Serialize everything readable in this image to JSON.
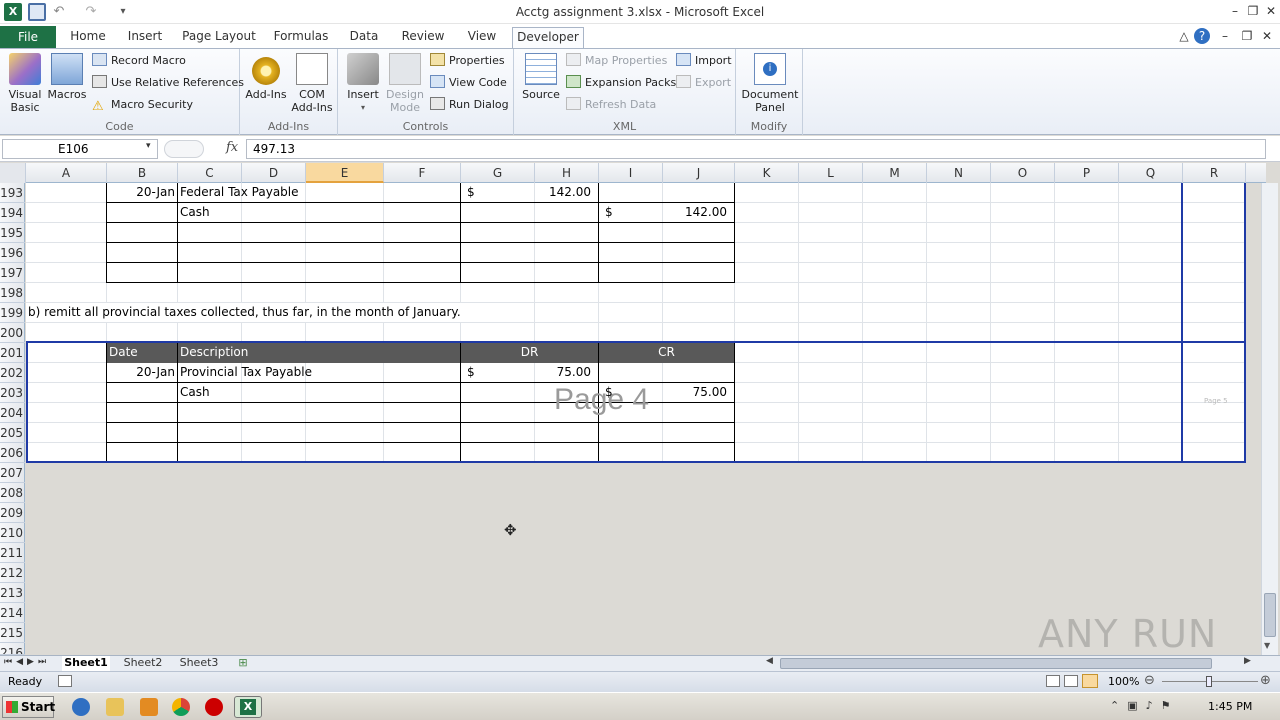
{
  "window": {
    "title": "Acctg assignment 3.xlsx - Microsoft Excel"
  },
  "ribbon_tabs": [
    "File",
    "Home",
    "Insert",
    "Page Layout",
    "Formulas",
    "Data",
    "Review",
    "View",
    "Developer"
  ],
  "ribbon": {
    "code": {
      "label": "Code",
      "visual_basic": "Visual Basic",
      "visual_basic_l1": "Visual",
      "visual_basic_l2": "Basic",
      "macros": "Macros",
      "record_macro": "Record Macro",
      "use_relative": "Use Relative References",
      "macro_security": "Macro Security"
    },
    "addins": {
      "label": "Add-Ins",
      "addins": "Add-Ins",
      "com_l1": "COM",
      "com_l2": "Add-Ins"
    },
    "controls": {
      "label": "Controls",
      "insert": "Insert",
      "design_l1": "Design",
      "design_l2": "Mode",
      "properties": "Properties",
      "view_code": "View Code",
      "run_dialog": "Run Dialog"
    },
    "xml": {
      "label": "XML",
      "source": "Source",
      "map_properties": "Map Properties",
      "expansion_packs": "Expansion Packs",
      "refresh_data": "Refresh Data",
      "import": "Import",
      "export": "Export"
    },
    "modify": {
      "label": "Modify",
      "doc_l1": "Document",
      "doc_l2": "Panel"
    }
  },
  "formula_bar": {
    "name_box": "E106",
    "fx": "fx",
    "value": "497.13"
  },
  "columns": [
    "A",
    "B",
    "C",
    "D",
    "E",
    "F",
    "G",
    "H",
    "I",
    "J",
    "K",
    "L",
    "M",
    "N",
    "O",
    "P",
    "Q",
    "R"
  ],
  "rows": [
    "193",
    "194",
    "195",
    "196",
    "197",
    "198",
    "199",
    "200",
    "201",
    "202",
    "203",
    "204",
    "205",
    "206",
    "207",
    "208",
    "209",
    "210",
    "211",
    "212",
    "213",
    "214",
    "215",
    "216"
  ],
  "cells": {
    "r193_date": "20-Jan",
    "r193_desc": "Federal Tax Payable",
    "r193_dr_sym": "$",
    "r193_dr": "142.00",
    "r194_desc": "Cash",
    "r194_cr_sym": "$",
    "r194_cr": "142.00",
    "r199_text": "b) remitt all provincial  taxes collected, thus far, in the month of January.",
    "r201_date": "Date",
    "r201_desc": "Description",
    "r201_dr": "DR",
    "r201_cr": "CR",
    "r202_date": "20-Jan",
    "r202_desc": "Provincial Tax Payable",
    "r202_dr_sym": "$",
    "r202_dr": "75.00",
    "r203_desc": "Cash",
    "r203_cr_sym": "$",
    "r203_cr": "75.00"
  },
  "page_labels": {
    "main": "Page 4",
    "small": "Page 5"
  },
  "sheet_tabs": [
    "Sheet1",
    "Sheet2",
    "Sheet3"
  ],
  "status": {
    "ready": "Ready",
    "zoom": "100%"
  },
  "taskbar": {
    "start": "Start",
    "clock": "1:45 PM"
  },
  "watermark": "ANY RUN",
  "colors": {
    "excel_green": "#1e7145",
    "page_break": "#1f3aa6",
    "table_header": "#595959",
    "selected_col": "#f9d99f"
  }
}
